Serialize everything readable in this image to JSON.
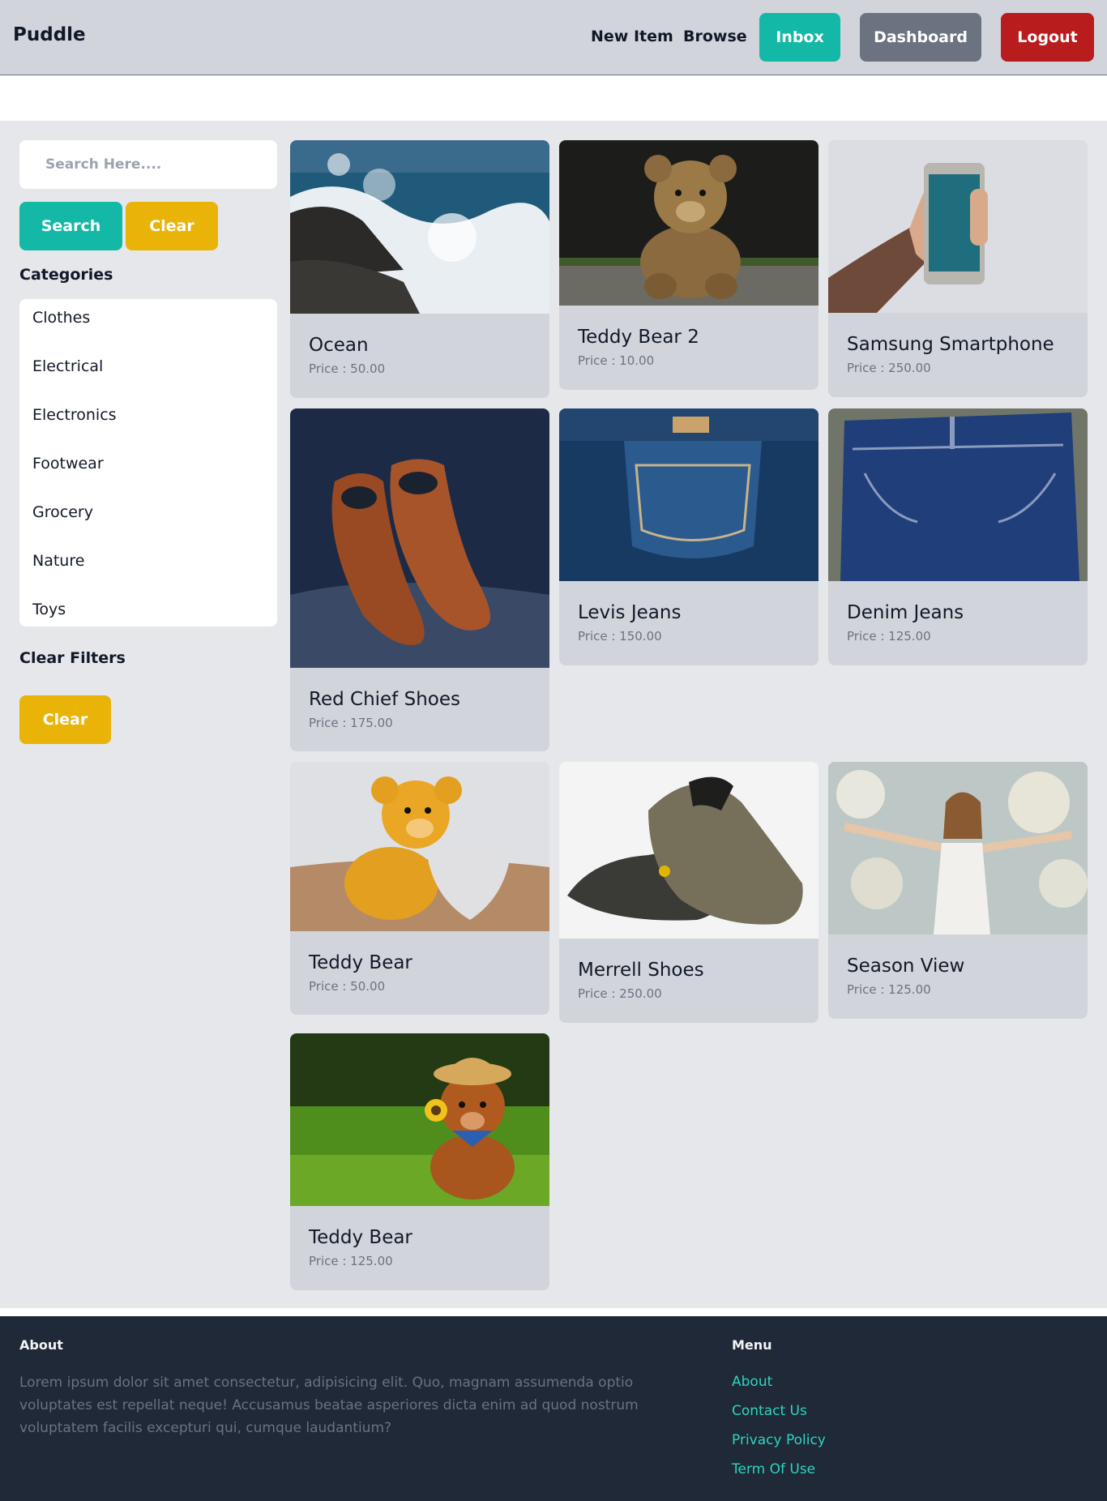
{
  "nav": {
    "brand": "Puddle",
    "links": [
      "New Item",
      "Browse"
    ],
    "inbox": "Inbox",
    "dashboard": "Dashboard",
    "logout": "Logout"
  },
  "sidebar": {
    "search_placeholder": "Search Here....",
    "search_button": "Search",
    "clear_button": "Clear",
    "categories_heading": "Categories",
    "categories": [
      "Clothes",
      "Electrical",
      "Electronics",
      "Footwear",
      "Grocery",
      "Nature",
      "Toys"
    ],
    "clear_filters_heading": "Clear Filters",
    "clear_filters_button": "Clear"
  },
  "items": [
    {
      "title": "Ocean",
      "price": "Price : 50.00",
      "image": "ocean-waves-photo"
    },
    {
      "title": "Teddy Bear 2",
      "price": "Price : 10.00",
      "image": "brown-teddy-bear-photo"
    },
    {
      "title": "Samsung Smartphone",
      "price": "Price : 250.00",
      "image": "hand-holding-smartphone-photo"
    },
    {
      "title": "Red Chief Shoes",
      "price": "Price : 175.00",
      "image": "leather-oxford-shoes-photo"
    },
    {
      "title": "Levis Jeans",
      "price": "Price : 150.00",
      "image": "folded-jeans-photo"
    },
    {
      "title": "Denim Jeans",
      "price": "Price : 125.00",
      "image": "denim-jeans-photo"
    },
    {
      "title": "Teddy Bear",
      "price": "Price : 50.00",
      "image": "teddy-bear-with-heart-photo"
    },
    {
      "title": "Merrell Shoes",
      "price": "Price : 250.00",
      "image": "hiking-shoes-photo"
    },
    {
      "title": "Season View",
      "price": "Price : 125.00",
      "image": "woman-in-blossoms-photo"
    },
    {
      "title": "Teddy Bear",
      "price": "Price : 125.00",
      "image": "teddy-bear-on-grass-photo"
    }
  ],
  "footer": {
    "about_heading": "About",
    "about_text": "Lorem ipsum dolor sit amet consectetur, adipisicing elit. Quo, magnam assumenda optio voluptates est repellat neque! Accusamus beatae asperiores dicta enim ad quod nostrum voluptatem facilis excepturi qui, cumque laudantium?",
    "menu_heading": "Menu",
    "menu_links": [
      "About",
      "Contact Us",
      "Privacy Policy",
      "Term Of Use"
    ]
  },
  "colors": {
    "accent": "#14b8a6",
    "warning": "#eab308",
    "danger": "#b91c1c",
    "neutral_button": "#6b7280",
    "footer_bg": "#1f2937",
    "footer_link": "#2dd4bf"
  }
}
